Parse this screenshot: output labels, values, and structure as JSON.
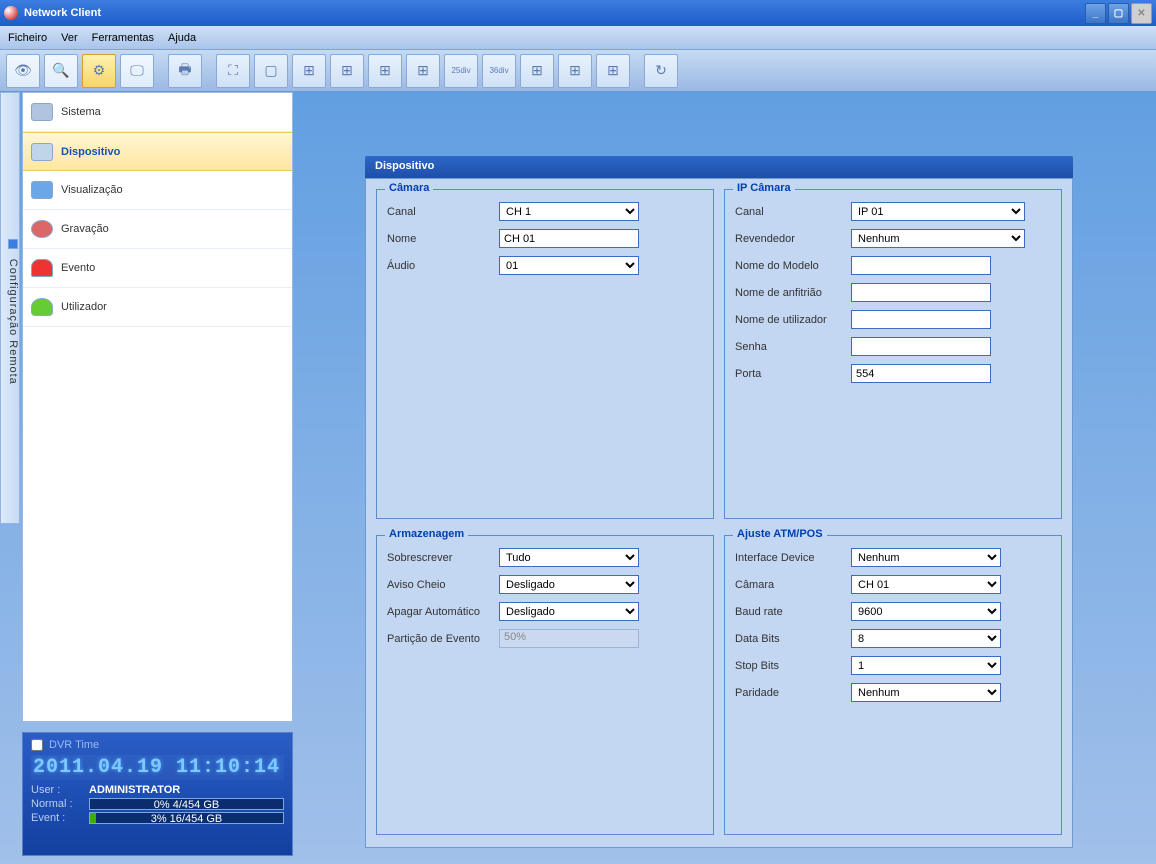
{
  "title": "Network Client",
  "menu": {
    "ficheiro": "Ficheiro",
    "ver": "Ver",
    "ferramentas": "Ferramentas",
    "ajuda": "Ajuda"
  },
  "vtab": {
    "label": "Configuração Remota"
  },
  "sidebar": {
    "items": [
      {
        "label": "Sistema"
      },
      {
        "label": "Dispositivo"
      },
      {
        "label": "Visualização"
      },
      {
        "label": "Gravação"
      },
      {
        "label": "Evento"
      },
      {
        "label": "Utilizador"
      }
    ]
  },
  "status": {
    "dvr_time_label": "DVR Time",
    "datetime": "2011.04.19 11:10:14",
    "user_label": "User :",
    "user_value": "ADMINISTRATOR",
    "normal_label": "Normal :",
    "normal_text": "0% 4/454 GB",
    "normal_pct": 0,
    "event_label": "Event  :",
    "event_text": "3% 16/454 GB",
    "event_pct": 3
  },
  "content": {
    "title": "Dispositivo",
    "camara": {
      "legend": "Câmara",
      "canal_label": "Canal",
      "canal_value": "CH 1",
      "nome_label": "Nome",
      "nome_value": "CH 01",
      "audio_label": "Áudio",
      "audio_value": "01"
    },
    "ip": {
      "legend": "IP Câmara",
      "canal_label": "Canal",
      "canal_value": "IP 01",
      "revend_label": "Revendedor",
      "revend_value": "Nenhum",
      "modelo_label": "Nome do Modelo",
      "modelo_value": "",
      "host_label": "Nome de anfitrião",
      "host_value": "",
      "user_label": "Nome de utilizador",
      "user_value": "",
      "senha_label": "Senha",
      "senha_value": "",
      "porta_label": "Porta",
      "porta_value": "554"
    },
    "storage": {
      "legend": "Armazenagem",
      "sobre_label": "Sobrescrever",
      "sobre_value": "Tudo",
      "aviso_label": "Aviso Cheio",
      "aviso_value": "Desligado",
      "apagar_label": "Apagar Automático",
      "apagar_value": "Desligado",
      "part_label": "Partição de Evento",
      "part_value": "50%"
    },
    "atm": {
      "legend": "Ajuste ATM/POS",
      "iface_label": "Interface Device",
      "iface_value": "Nenhum",
      "cam_label": "Câmara",
      "cam_value": "CH 01",
      "baud_label": "Baud rate",
      "baud_value": "9600",
      "data_label": "Data Bits",
      "data_value": "8",
      "stop_label": "Stop Bits",
      "stop_value": "1",
      "par_label": "Paridade",
      "par_value": "Nenhum"
    }
  }
}
